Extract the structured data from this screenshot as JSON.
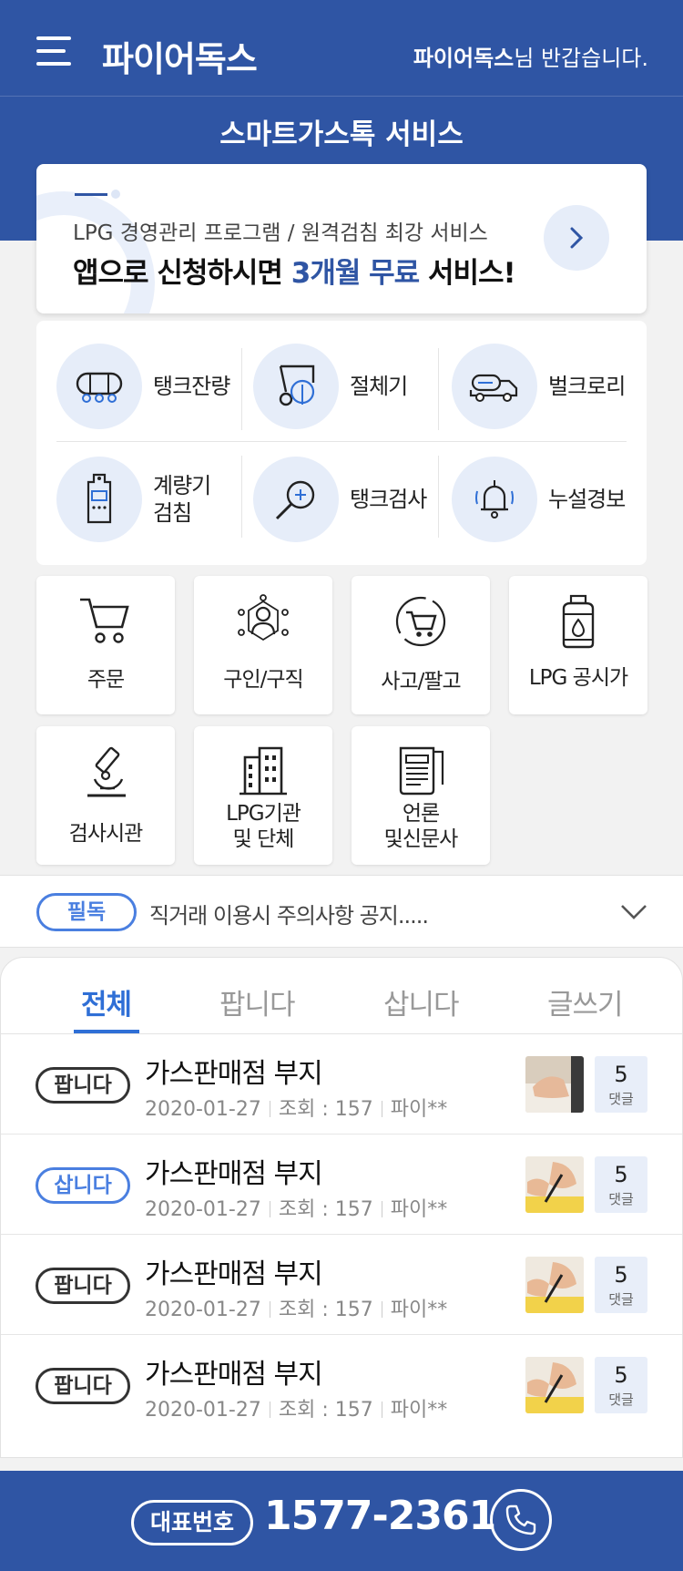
{
  "header": {
    "app_title": "파이어독스",
    "greeting_name": "파이어독스",
    "greeting_suffix": "님 반갑습니다.",
    "service_title": "스마트가스톡 서비스"
  },
  "promo": {
    "subtitle": "LPG 경영관리 프로그램 / 원격검침 최강 서비스",
    "main_prefix": "앱으로 신청하시면 ",
    "main_highlight": "3개월 무료",
    "main_suffix": " 서비스!"
  },
  "services": [
    {
      "label": "탱크잔량",
      "icon": "tank-icon"
    },
    {
      "label": "절체기",
      "icon": "switcher-icon"
    },
    {
      "label": "벌크로리",
      "icon": "bulk-lorry-icon"
    },
    {
      "label_line1": "계량기",
      "label_line2": "검침",
      "icon": "meter-icon"
    },
    {
      "label": "탱크검사",
      "icon": "magnifier-icon"
    },
    {
      "label": "누설경보",
      "icon": "bell-icon"
    }
  ],
  "tiles": [
    {
      "label": "주문",
      "icon": "cart-icon"
    },
    {
      "label": "구인/구직",
      "icon": "recruit-icon"
    },
    {
      "label": "사고/팔고",
      "icon": "trade-cart-icon"
    },
    {
      "label": "LPG 공시가",
      "icon": "gas-cylinder-icon"
    },
    {
      "label": "검사시관",
      "icon": "microscope-icon"
    },
    {
      "label_line1": "LPG기관",
      "label_line2": "및 단체",
      "icon": "building-icon"
    },
    {
      "label_line1": "언론",
      "label_line2": "및신문사",
      "icon": "newspaper-icon"
    }
  ],
  "notice": {
    "badge": "필독",
    "text": "직거래 이용시 주의사항 공지....."
  },
  "tabs": [
    "전체",
    "팝니다",
    "삽니다",
    "글쓰기"
  ],
  "posts": [
    {
      "badge": "팝니다",
      "type": "sell",
      "title": "가스판매점 부지",
      "date": "2020-01-27",
      "views": "조회 : 157",
      "author": "파이**",
      "comments": "5",
      "comment_label": "댓글"
    },
    {
      "badge": "삽니다",
      "type": "buy",
      "title": "가스판매점 부지",
      "date": "2020-01-27",
      "views": "조회 : 157",
      "author": "파이**",
      "comments": "5",
      "comment_label": "댓글"
    },
    {
      "badge": "팝니다",
      "type": "sell",
      "title": "가스판매점 부지",
      "date": "2020-01-27",
      "views": "조회 : 157",
      "author": "파이**",
      "comments": "5",
      "comment_label": "댓글"
    },
    {
      "badge": "팝니다",
      "type": "sell",
      "title": "가스판매점 부지",
      "date": "2020-01-27",
      "views": "조회 : 157",
      "author": "파이**",
      "comments": "5",
      "comment_label": "댓글"
    }
  ],
  "footer": {
    "label": "대표번호",
    "phone": "1577-2361"
  },
  "colors": {
    "primary": "#2f55a4",
    "accent": "#2f6fd6",
    "light_bg": "#e6edf9"
  }
}
